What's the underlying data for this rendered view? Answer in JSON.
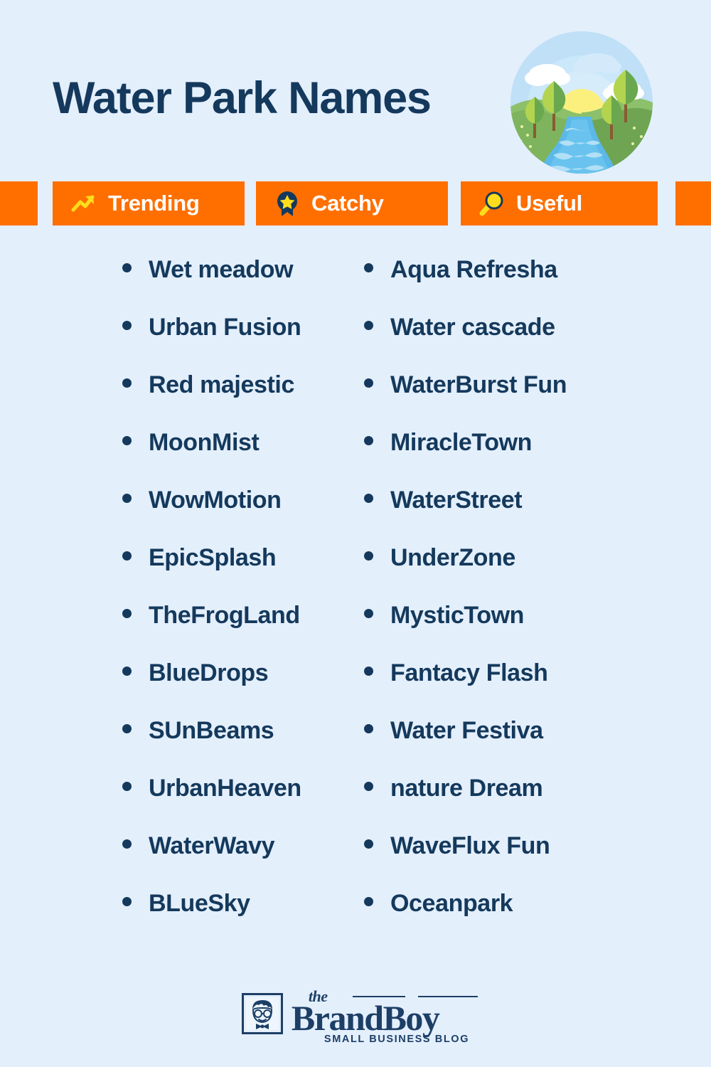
{
  "header": {
    "title": "Water Park Names",
    "illustration": "nature-river-sunset-icon"
  },
  "badges": [
    {
      "label": "Trending",
      "icon": "trending-up-icon"
    },
    {
      "label": "Catchy",
      "icon": "award-ribbon-icon"
    },
    {
      "label": "Useful",
      "icon": "magnifying-glass-icon"
    }
  ],
  "colors": {
    "background": "#e4effc",
    "accent_orange": "#ff6f00",
    "text_navy": "#14395c",
    "icon_yellow": "#ffdd1c",
    "badge_text": "#ffffff"
  },
  "names": {
    "left_column": [
      "Wet meadow",
      "Urban Fusion",
      "Red majestic",
      "MoonMist",
      "WowMotion",
      "EpicSplash",
      "TheFrogLand",
      "BlueDrops",
      "SUnBeams",
      "UrbanHeaven",
      "WaterWavy",
      "BLueSky"
    ],
    "right_column": [
      "Aqua Refresha",
      "Water cascade",
      "WaterBurst Fun",
      "MiracleTown",
      "WaterStreet",
      "UnderZone",
      "MysticTown",
      "Fantacy Flash",
      "Water Festiva",
      "nature Dream",
      "WaveFlux Fun",
      "Oceanpark"
    ]
  },
  "footer": {
    "logo_the": "the",
    "logo_brand": "BrandBoy",
    "logo_tagline": "SMALL BUSINESS BLOG",
    "logo_mark": "boy-face-icon"
  }
}
